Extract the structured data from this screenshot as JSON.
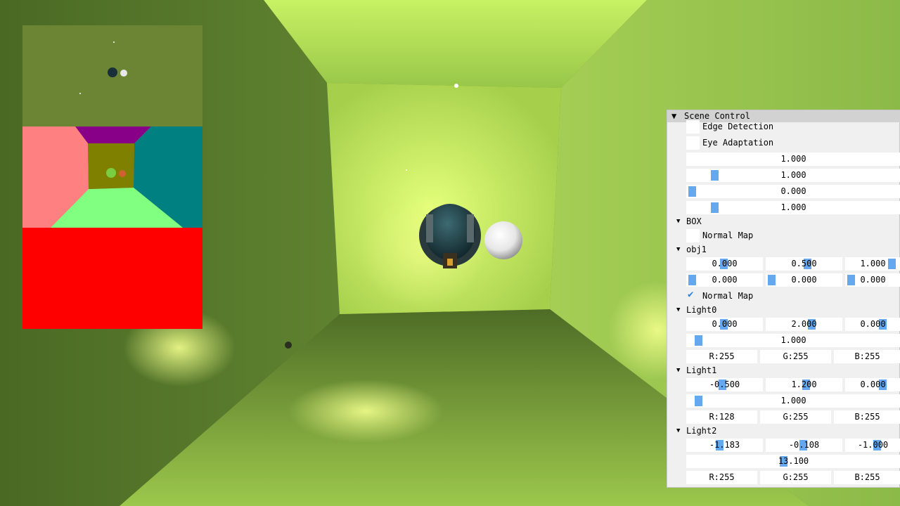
{
  "scene_control": {
    "title": "Scene Control",
    "edge_detection": {
      "label": "Edge Detection",
      "checked": false
    },
    "eye_adaptation": {
      "label": "Eye Adaptation",
      "checked": false
    },
    "sliders": [
      "1.000",
      "1.000",
      "0.000",
      "1.000"
    ],
    "box": {
      "label": "BOX",
      "normal_map": {
        "label": "Normal Map",
        "checked": false
      }
    },
    "obj1": {
      "label": "obj1",
      "position": [
        "0.000",
        "0.500",
        "1.000"
      ],
      "rotation": [
        "0.000",
        "0.000",
        "0.000"
      ],
      "normal_map": {
        "label": "Normal Map",
        "checked": true
      }
    },
    "light0": {
      "label": "Light0",
      "position": [
        "0.000",
        "2.000",
        "0.000"
      ],
      "intensity": "1.000",
      "color": [
        "R:255",
        "G:255",
        "B:255"
      ]
    },
    "light1": {
      "label": "Light1",
      "position": [
        "-0.500",
        "1.200",
        "0.000"
      ],
      "intensity": "1.000",
      "color": [
        "R:128",
        "G:255",
        "B:255"
      ]
    },
    "light2": {
      "label": "Light2",
      "position": [
        "-1.183",
        "-0.108",
        "-1.000"
      ],
      "intensity": "13.100",
      "color": [
        "R:255",
        "G:255",
        "B:255"
      ]
    }
  },
  "colors": {
    "panel_bg": "#f0f0f0",
    "title_bg": "#d2d2d2",
    "slider_grab": "#64a8f0",
    "check_mark": "#2a7fe0"
  }
}
